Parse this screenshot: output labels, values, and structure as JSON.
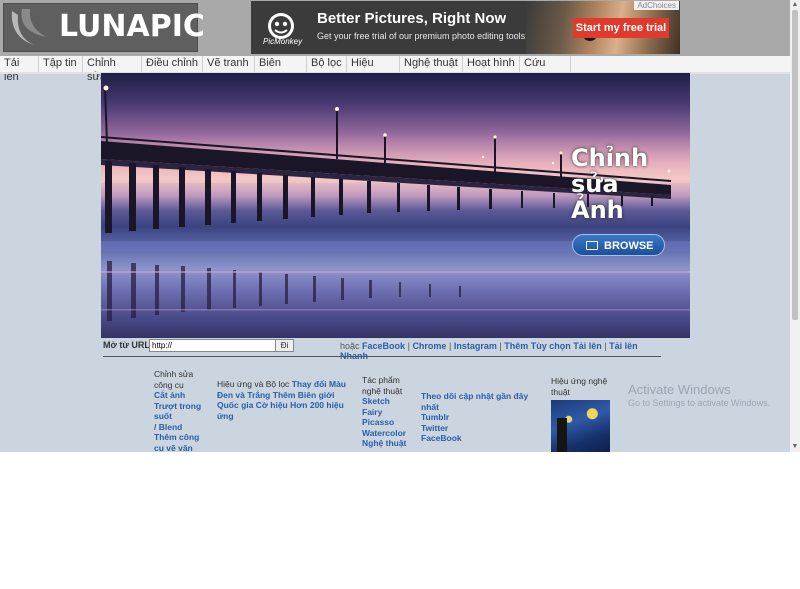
{
  "header": {
    "logo_text": "LUNAPIC"
  },
  "ad": {
    "brand": "PicMonkey",
    "headline": "Better Pictures, Right Now",
    "subtext": "Get your free trial of our premium photo editing tools.",
    "cta": "Start my free trial",
    "adchoices": "AdChoices"
  },
  "menu": {
    "items": [
      "Tải lên",
      "Tập tin",
      "Chỉnh sửa",
      "Điều chỉnh",
      "Vẽ tranh",
      "Biên giới",
      "Bộ lọc",
      "Hiệu ứng",
      "Nghệ thuật",
      "Hoạt hình",
      "Cứu giúp"
    ]
  },
  "hero": {
    "title_line1": "Chỉnh",
    "title_line2": "sửa",
    "title_line3": "Ảnh",
    "browse": "BROWSE"
  },
  "url_row": {
    "label": "Mở từ URL:",
    "input_value": "http://",
    "go": "Đi",
    "or": "hoặc",
    "links": [
      "FaceBook",
      "Chrome",
      "Instagram",
      "Thêm Tùy chọn Tải lên",
      "Tải lên Nhanh"
    ]
  },
  "footer": {
    "col1": {
      "heading": "Chỉnh sửa công cụ",
      "links": [
        "Cắt ảnh",
        "Trượt trong suốt",
        "/ Blend",
        "Thêm công cụ vẽ văn"
      ]
    },
    "col2": {
      "heading": "Hiệu ứng và Bộ lọc",
      "links": [
        "Thay đổi Màu",
        "Đen và Trắng",
        "Thêm Biên giới",
        "Quốc gia Cờ hiệu Hơn 200 hiệu ứng"
      ]
    },
    "col3": {
      "heading": "Tác phẩm nghệ thuật",
      "links": [
        "Sketch",
        "Fairy",
        "Picasso",
        "Watercolor",
        "Nghệ thuật"
      ]
    },
    "col4": {
      "links": [
        "Theo dõi cập nhật gần đây nhất",
        "Tumblr",
        "Twitter",
        "FaceBook"
      ]
    },
    "col5": {
      "heading": "Hiệu ứng nghệ thuật"
    }
  },
  "watermark": {
    "line1": "Activate Windows",
    "line2": "Go to Settings to activate Windows."
  }
}
